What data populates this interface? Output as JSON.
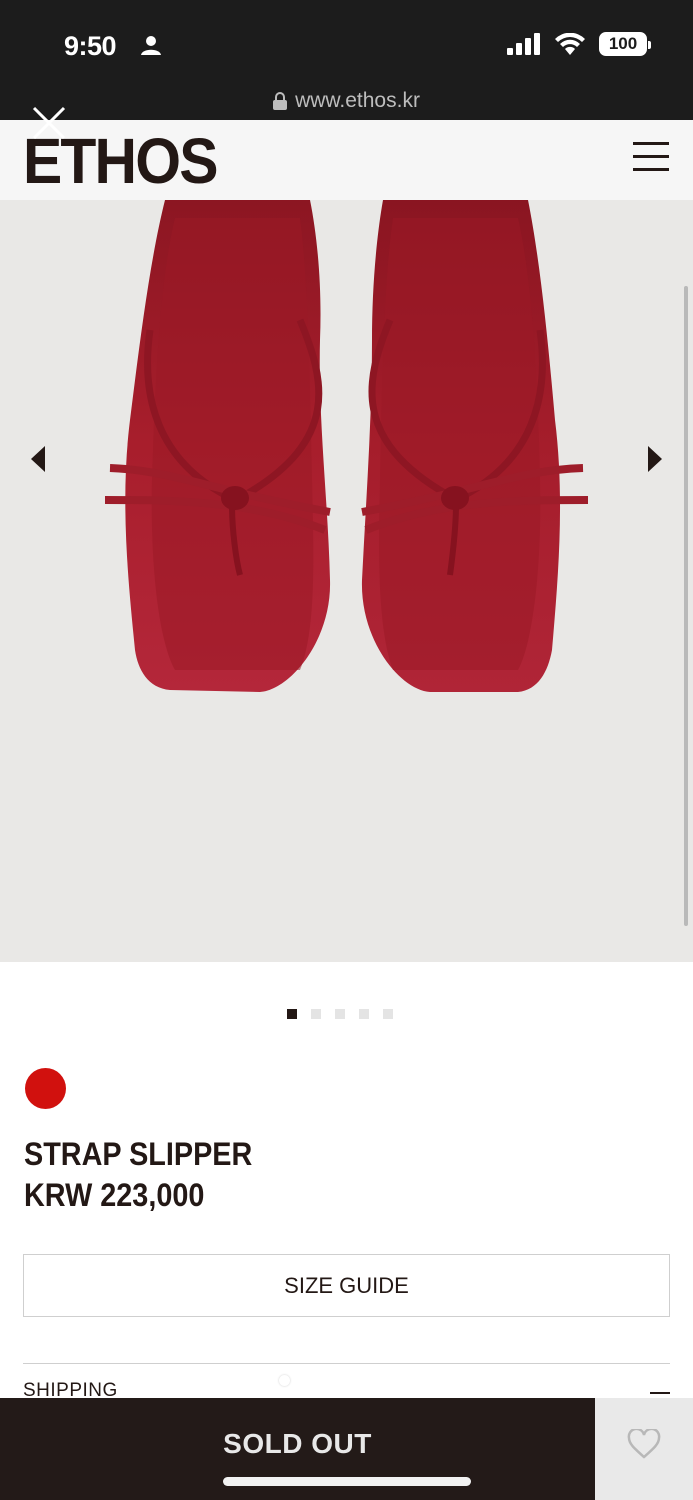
{
  "status_bar": {
    "time": "9:50"
  },
  "browser": {
    "url": "www.ethos.kr"
  },
  "header": {
    "logo": "ETHOS"
  },
  "product": {
    "images_count": 5,
    "active_image": 1,
    "color_swatch": "#d1110e",
    "name": "STRAP SLIPPER",
    "price": "KRW 223,000",
    "sandal_color": "#a61d2b"
  },
  "actions": {
    "size_guide": "SIZE GUIDE",
    "shipping": "SHIPPING",
    "sold_out": "SOLD OUT"
  },
  "colors": {
    "brand_dark": "#231815",
    "gallery_bg": "#e9e8e6"
  }
}
